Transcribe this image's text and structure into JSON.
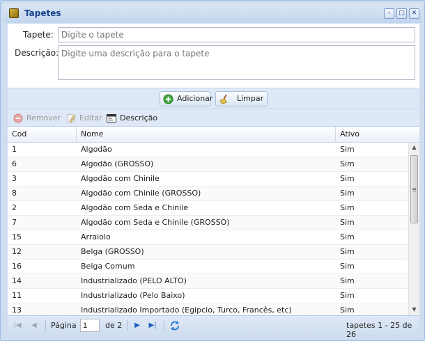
{
  "window": {
    "title": "Tapetes",
    "controls": {
      "minimize": "–",
      "maximize": "□",
      "close": "✕"
    }
  },
  "form": {
    "tapete_label": "Tapete:",
    "tapete_placeholder": "Digite o tapete",
    "tapete_value": "",
    "descricao_label": "Descrição:",
    "descricao_placeholder": "Digite uma descrição para o tapete",
    "descricao_value": ""
  },
  "buttons": {
    "adicionar": "Adicionar",
    "limpar": "Limpar"
  },
  "toolbar": {
    "remover": "Remover",
    "editar": "Editar",
    "descricao": "Descrição"
  },
  "grid": {
    "columns": [
      "Cod",
      "Nome",
      "Ativo"
    ],
    "rows": [
      {
        "cod": "1",
        "nome": "Algodão",
        "ativo": "Sim"
      },
      {
        "cod": "6",
        "nome": "Algodão (GROSSO)",
        "ativo": "Sim"
      },
      {
        "cod": "3",
        "nome": "Algodão com Chinile",
        "ativo": "Sim"
      },
      {
        "cod": "8",
        "nome": "Algodão com Chinile (GROSSO)",
        "ativo": "Sim"
      },
      {
        "cod": "2",
        "nome": "Algodão com Seda e Chinile",
        "ativo": "Sim"
      },
      {
        "cod": "7",
        "nome": "Algodão com Seda e Chinile (GROSSO)",
        "ativo": "Sim"
      },
      {
        "cod": "15",
        "nome": "Arraiolo",
        "ativo": "Sim"
      },
      {
        "cod": "12",
        "nome": "Belga (GROSSO)",
        "ativo": "Sim"
      },
      {
        "cod": "16",
        "nome": "Belga Comum",
        "ativo": "Sim"
      },
      {
        "cod": "14",
        "nome": "Industrializado (PELO ALTO)",
        "ativo": "Sim"
      },
      {
        "cod": "11",
        "nome": "Industrializado (Pelo Baixo)",
        "ativo": "Sim"
      },
      {
        "cod": "13",
        "nome": "Industrializado Importado (Egipcio, Turco, Francês, etc)",
        "ativo": "Sim"
      }
    ]
  },
  "paging": {
    "page_label": "Página",
    "current_page": "1",
    "of_label": "de 2",
    "summary": "tapetes 1 - 25 de 26"
  },
  "colors": {
    "title_text": "#15428b",
    "frame": "#cfdeef",
    "toolbar_bg": "#dfe8f6"
  }
}
